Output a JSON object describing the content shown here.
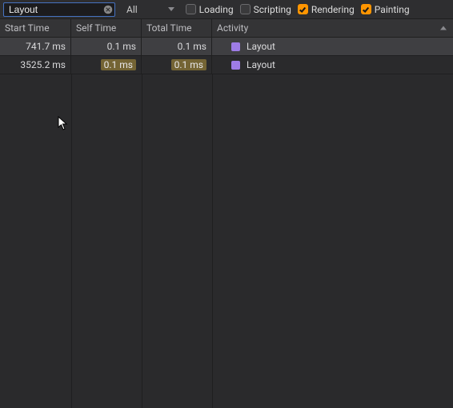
{
  "toolbar": {
    "filter_value": "Layout",
    "scope": {
      "selected": "All"
    },
    "categories": {
      "loading": {
        "label": "Loading",
        "checked": false
      },
      "scripting": {
        "label": "Scripting",
        "checked": false
      },
      "rendering": {
        "label": "Rendering",
        "checked": true
      },
      "painting": {
        "label": "Painting",
        "checked": true
      }
    }
  },
  "columns": {
    "start": "Start Time",
    "self": "Self Time",
    "total": "Total Time",
    "activity": "Activity"
  },
  "rows": [
    {
      "start": "741.7 ms",
      "self": "0.1 ms",
      "total": "0.1 ms",
      "activity": "Layout",
      "color": "#9e7ce6",
      "selected": true,
      "highlight": false
    },
    {
      "start": "3525.2 ms",
      "self": "0.1 ms",
      "total": "0.1 ms",
      "activity": "Layout",
      "color": "#9e7ce6",
      "selected": false,
      "highlight": true
    }
  ]
}
